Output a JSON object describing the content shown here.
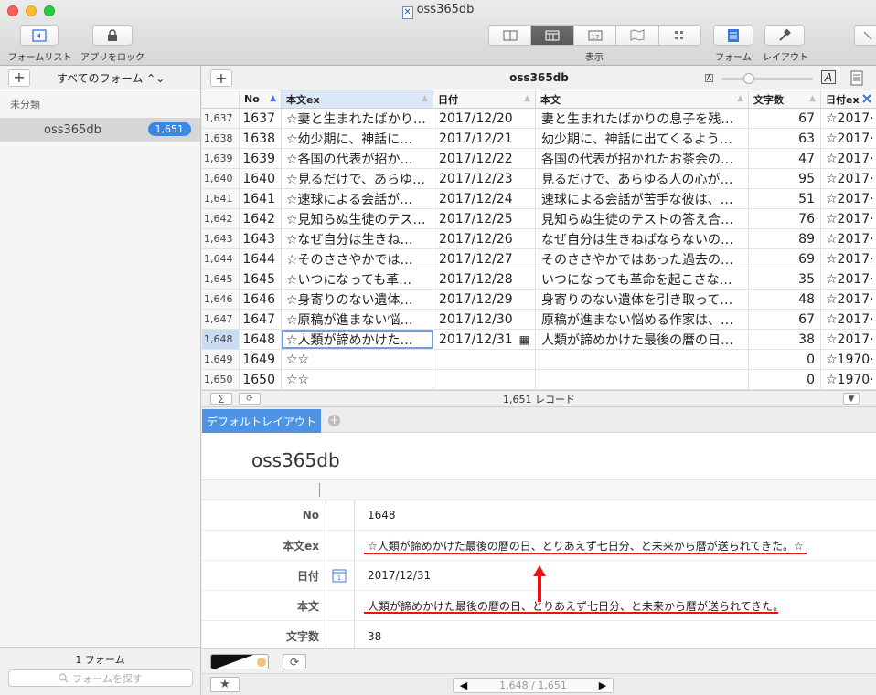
{
  "window": {
    "title": "oss365db"
  },
  "toolbar": {
    "form_list_label": "フォームリスト",
    "app_lock_label": "アプリをロック",
    "view_label": "表示",
    "form_label": "フォーム",
    "layout_label": "レイアウト"
  },
  "sidebar": {
    "filter_label": "すべてのフォーム ⌃⌄",
    "group_label": "未分類",
    "items": [
      {
        "label": "oss365db",
        "count": "1,651"
      }
    ],
    "footer_count": "1 フォーム",
    "search_placeholder": "フォームを探す"
  },
  "main": {
    "title": "oss365db",
    "columns": [
      "No",
      "本文ex",
      "日付",
      "本文",
      "文字数",
      "日付ex"
    ],
    "rows": [
      {
        "idx": "1,637",
        "no": "1637",
        "ex": "☆妻と生まれたばかり…",
        "date": "2017/12/20",
        "body": "妻と生まれたばかりの息子を残…",
        "cnt": "67",
        "dex": "☆2017·"
      },
      {
        "idx": "1,638",
        "no": "1638",
        "ex": "☆幼少期に、神話に…",
        "date": "2017/12/21",
        "body": "幼少期に、神話に出てくるよう…",
        "cnt": "63",
        "dex": "☆2017·"
      },
      {
        "idx": "1,639",
        "no": "1639",
        "ex": "☆各国の代表が招か…",
        "date": "2017/12/22",
        "body": "各国の代表が招かれたお茶会の…",
        "cnt": "47",
        "dex": "☆2017·"
      },
      {
        "idx": "1,640",
        "no": "1640",
        "ex": "☆見るだけで、あらゆ…",
        "date": "2017/12/23",
        "body": "見るだけで、あらゆる人の心が…",
        "cnt": "95",
        "dex": "☆2017·"
      },
      {
        "idx": "1,641",
        "no": "1641",
        "ex": "☆速球による会話が…",
        "date": "2017/12/24",
        "body": "速球による会話が苦手な彼は、…",
        "cnt": "51",
        "dex": "☆2017·"
      },
      {
        "idx": "1,642",
        "no": "1642",
        "ex": "☆見知らぬ生徒のテス…",
        "date": "2017/12/25",
        "body": "見知らぬ生徒のテストの答え合…",
        "cnt": "76",
        "dex": "☆2017·"
      },
      {
        "idx": "1,643",
        "no": "1643",
        "ex": "☆なぜ自分は生きね…",
        "date": "2017/12/26",
        "body": "なぜ自分は生きねばならないの…",
        "cnt": "89",
        "dex": "☆2017·"
      },
      {
        "idx": "1,644",
        "no": "1644",
        "ex": "☆そのささやかでは…",
        "date": "2017/12/27",
        "body": "そのささやかではあった過去の…",
        "cnt": "69",
        "dex": "☆2017·"
      },
      {
        "idx": "1,645",
        "no": "1645",
        "ex": "☆いつになっても革…",
        "date": "2017/12/28",
        "body": "いつになっても革命を起こさな…",
        "cnt": "35",
        "dex": "☆2017·"
      },
      {
        "idx": "1,646",
        "no": "1646",
        "ex": "☆身寄りのない遺体…",
        "date": "2017/12/29",
        "body": "身寄りのない遺体を引き取って…",
        "cnt": "48",
        "dex": "☆2017·"
      },
      {
        "idx": "1,647",
        "no": "1647",
        "ex": "☆原稿が進まない悩…",
        "date": "2017/12/30",
        "body": "原稿が進まない悩める作家は、…",
        "cnt": "67",
        "dex": "☆2017·"
      },
      {
        "idx": "1,648",
        "no": "1648",
        "ex": "☆人類が諦めかけた…",
        "date": "2017/12/31",
        "body": "人類が諦めかけた最後の暦の日…",
        "cnt": "38",
        "dex": "☆2017·"
      },
      {
        "idx": "1,649",
        "no": "1649",
        "ex": "☆☆",
        "date": "",
        "body": "",
        "cnt": "0",
        "dex": "☆1970·"
      },
      {
        "idx": "1,650",
        "no": "1650",
        "ex": "☆☆",
        "date": "",
        "body": "",
        "cnt": "0",
        "dex": "☆1970·"
      }
    ],
    "record_count": "1,651 レコード",
    "layout_tab": "デフォルトレイアウト",
    "form_title": "oss365db",
    "fields": [
      {
        "label": "No",
        "value": "1648"
      },
      {
        "label": "本文ex",
        "value": "☆人類が諦めかけた最後の暦の日、とりあえず七日分、と未来から暦が送られてきた。☆"
      },
      {
        "label": "日付",
        "value": "2017/12/31"
      },
      {
        "label": "本文",
        "value": "人類が諦めかけた最後の暦の日、とりあえず七日分、と未来から暦が送られてきた。"
      },
      {
        "label": "文字数",
        "value": "38"
      }
    ],
    "pager": "1,648 / 1,651"
  },
  "colors": {
    "accent": "#4e93e4",
    "annotation": "#ee1111"
  }
}
